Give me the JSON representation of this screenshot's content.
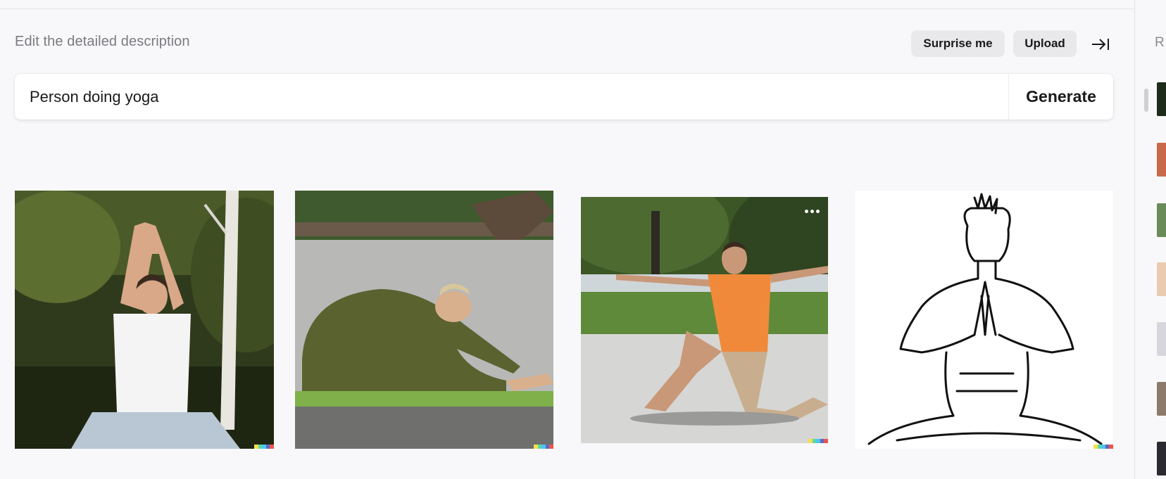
{
  "header": {
    "description_label": "Edit the detailed description",
    "surprise_label": "Surprise me",
    "upload_label": "Upload"
  },
  "prompt": {
    "value": "Person doing yoga",
    "generate_label": "Generate"
  },
  "results": [
    {
      "name": "yoga-photo-man-white-shirt-raised-hands"
    },
    {
      "name": "yoga-photo-man-seated-forward-bend"
    },
    {
      "name": "yoga-photo-man-orange-shirt-warrior-pose"
    },
    {
      "name": "yoga-sketch-seated-prayer-pose"
    }
  ],
  "sidebar": {
    "label": "R"
  },
  "colors": {
    "background": "#f8f8fa",
    "pill": "#e9e9ec",
    "text_muted": "#7a7a80",
    "badge": [
      "#f4e04d",
      "#57d9a3",
      "#4fc3f7",
      "#5c6bc0",
      "#ef5350"
    ]
  }
}
